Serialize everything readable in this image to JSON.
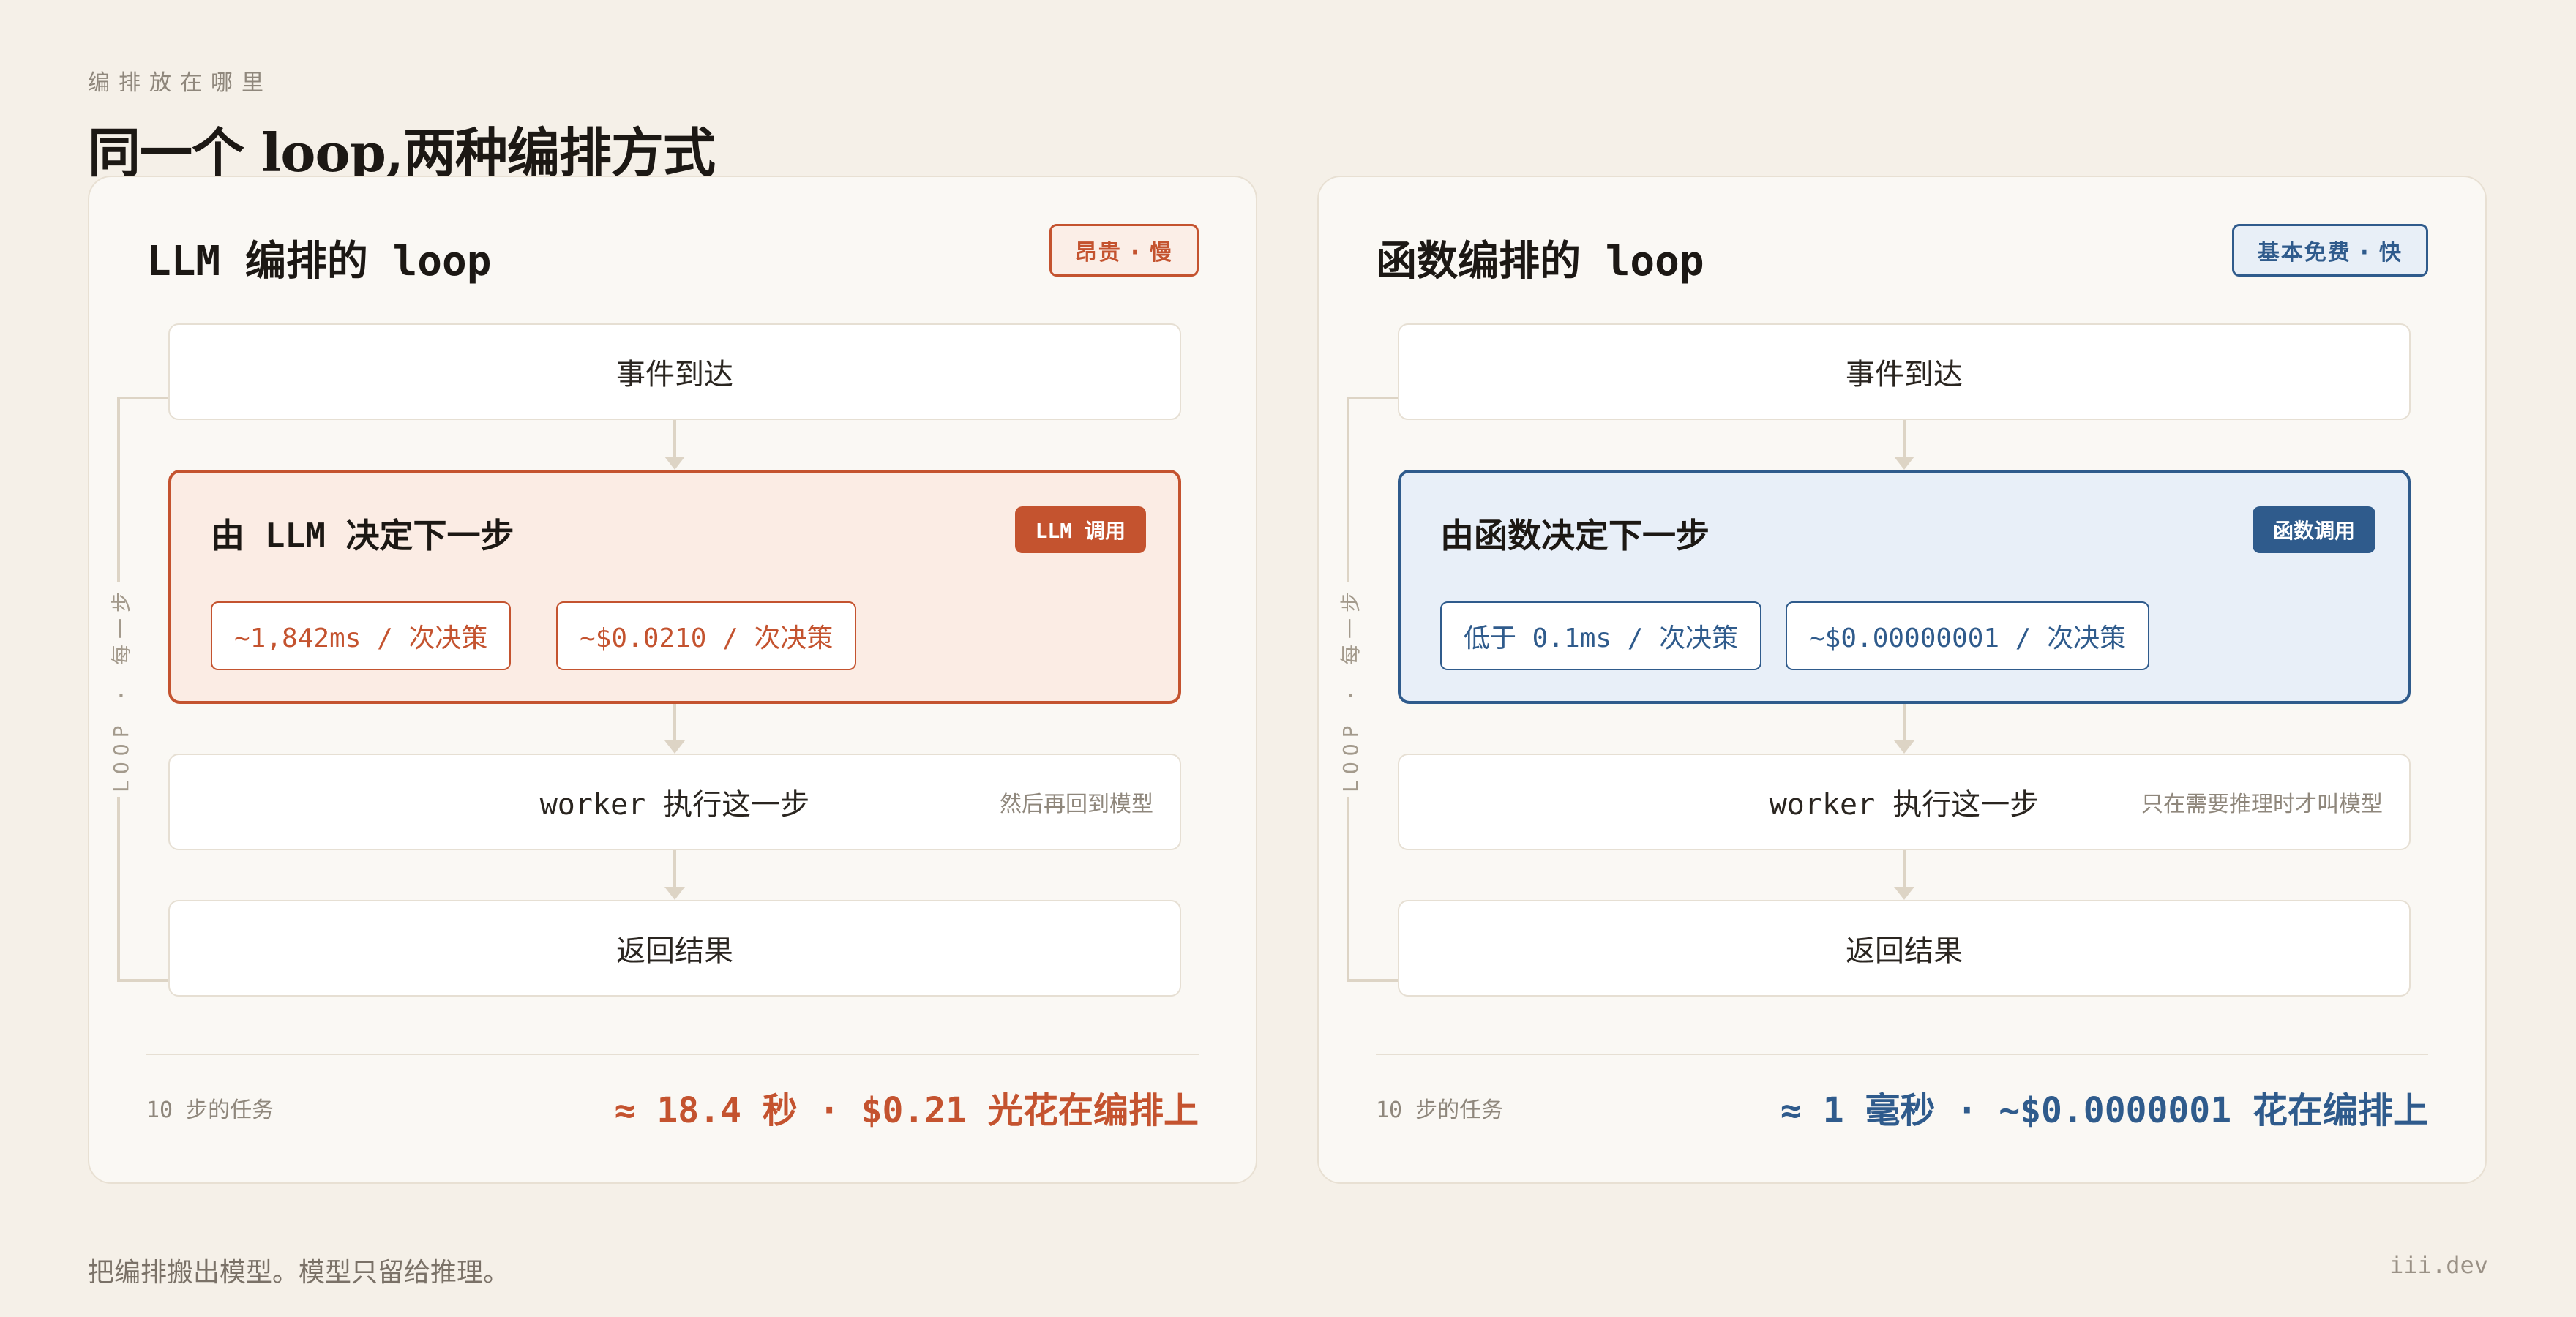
{
  "header": {
    "eyebrow": "编排放在哪里",
    "title": "同一个 loop,两种编排方式"
  },
  "panels": [
    {
      "title": "LLM 编排的 loop",
      "tag": "昂贵 · 慢",
      "loop_label": "LOOP · 每一步",
      "steps": {
        "event": "事件到达",
        "worker": "worker 执行这一步",
        "worker_note": "然后再回到模型",
        "result": "返回结果"
      },
      "decision": {
        "title": "由 LLM 决定下一步",
        "badge": "LLM 调用",
        "chips": [
          "~1,842ms / 次决策",
          "~$0.0210 / 次决策"
        ]
      },
      "footer": {
        "left": "10 步的任务",
        "right": "≈ 18.4 秒 · $0.21 光花在编排上"
      },
      "accent": "#c4532f"
    },
    {
      "title": "函数编排的 loop",
      "tag": "基本免费 · 快",
      "loop_label": "LOOP · 每一步",
      "steps": {
        "event": "事件到达",
        "worker": "worker 执行这一步",
        "worker_note": "只在需要推理时才叫模型",
        "result": "返回结果"
      },
      "decision": {
        "title": "由函数决定下一步",
        "badge": "函数调用",
        "chips": [
          "低于 0.1ms / 次决策",
          "~$0.00000001 / 次决策"
        ]
      },
      "footer": {
        "left": "10 步的任务",
        "right": "≈ 1 毫秒 · ~$0.0000001 花在编排上"
      },
      "accent": "#2f5b8c"
    }
  ],
  "bottom_note": "把编排搬出模型。模型只留给推理。",
  "site": "iii.dev"
}
